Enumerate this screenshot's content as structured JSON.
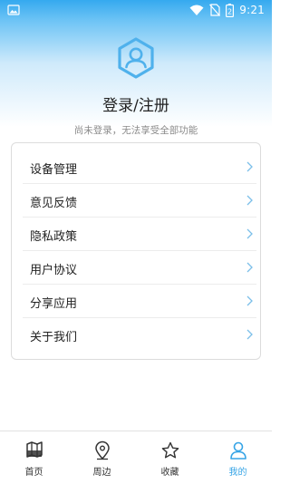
{
  "status_bar": {
    "time": "9:21",
    "icons": [
      "image-icon",
      "wifi-icon",
      "no-sim-icon",
      "battery-icon"
    ],
    "battery_level": "2"
  },
  "profile": {
    "title": "登录/注册",
    "subtitle": "尚未登录，无法享受全部功能",
    "avatar_icon": "user-hexagon-icon"
  },
  "menu": {
    "items": [
      {
        "label": "设备管理"
      },
      {
        "label": "意见反馈"
      },
      {
        "label": "隐私政策"
      },
      {
        "label": "用户协议"
      },
      {
        "label": "分享应用"
      },
      {
        "label": "关于我们"
      }
    ]
  },
  "tabbar": {
    "tabs": [
      {
        "label": "首页",
        "icon": "map-icon",
        "active": false
      },
      {
        "label": "周边",
        "icon": "location-pin-icon",
        "active": false
      },
      {
        "label": "收藏",
        "icon": "star-icon",
        "active": false
      },
      {
        "label": "我的",
        "icon": "user-icon",
        "active": true
      }
    ]
  },
  "colors": {
    "accent": "#36a4e6",
    "header_top": "#35a9ef",
    "text": "#222222",
    "muted": "#8a8a8a"
  }
}
